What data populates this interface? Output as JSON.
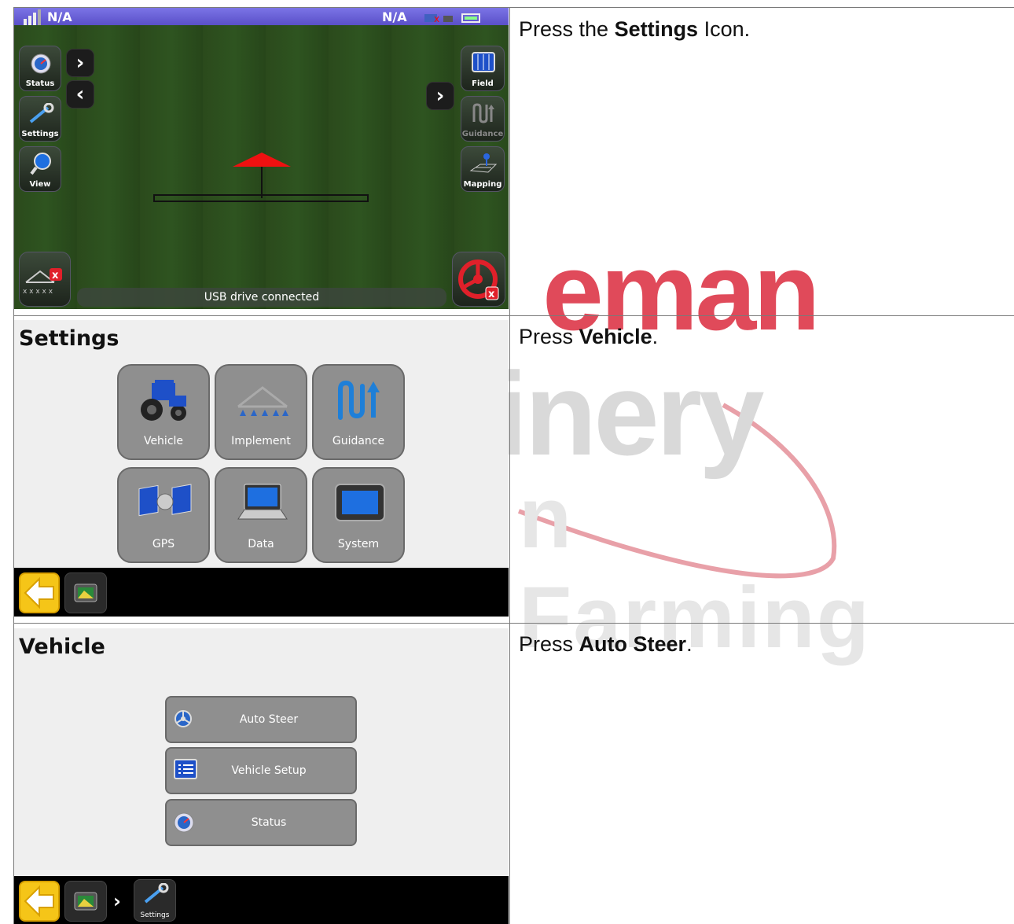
{
  "rows": [
    {
      "instruction_prefix": "Press the ",
      "instruction_bold": "Settings",
      "instruction_suffix": " Icon.",
      "screen": {
        "top_left_status": "N/A",
        "top_right_status": "N/A",
        "left_buttons": [
          {
            "label": "Status",
            "icon": "gauge-icon"
          },
          {
            "label": "Settings",
            "icon": "wrench-icon"
          },
          {
            "label": "View",
            "icon": "magnifier-icon"
          }
        ],
        "right_buttons": [
          {
            "label": "Field",
            "icon": "field-icon"
          },
          {
            "label": "Guidance",
            "icon": "guidance-icon"
          },
          {
            "label": "Mapping",
            "icon": "mapping-icon"
          }
        ],
        "status_message": "USB drive connected"
      }
    },
    {
      "instruction_prefix": "Press ",
      "instruction_bold": "Vehicle",
      "instruction_suffix": ".",
      "screen": {
        "title": "Settings",
        "tiles": [
          {
            "label": "Vehicle",
            "icon": "tractor-icon"
          },
          {
            "label": "Implement",
            "icon": "implement-icon"
          },
          {
            "label": "Guidance",
            "icon": "guidance-icon"
          },
          {
            "label": "GPS",
            "icon": "satellite-icon"
          },
          {
            "label": "Data",
            "icon": "laptop-icon"
          },
          {
            "label": "System",
            "icon": "display-icon"
          }
        ]
      }
    },
    {
      "instruction_prefix": "Press ",
      "instruction_bold": "Auto Steer",
      "instruction_suffix": ".",
      "screen": {
        "title": "Vehicle",
        "menu": [
          {
            "label": "Auto Steer",
            "icon": "steering-wheel-icon"
          },
          {
            "label": "Vehicle Setup",
            "icon": "list-icon"
          },
          {
            "label": "Status",
            "icon": "gauge-icon"
          }
        ],
        "breadcrumb_label": "Settings"
      }
    }
  ],
  "watermark": {
    "line1": "eman",
    "line2": "inery",
    "line3": "n Farming"
  },
  "colors": {
    "accent_yellow": "#f5c518",
    "watermark_red": "#e04a5a",
    "guidance_blue": "#1e7fd8",
    "tile_grey": "#8f8f8f"
  }
}
